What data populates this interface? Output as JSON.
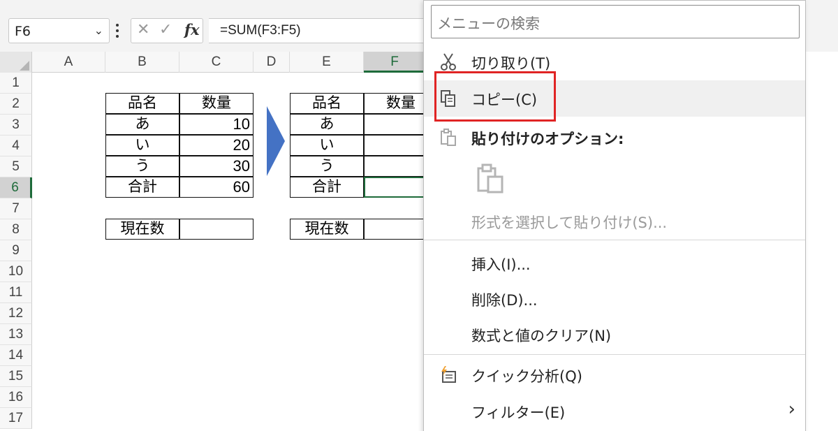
{
  "formula_bar": {
    "name_box": "F6",
    "name_box_chevron": "⌄",
    "cancel_icon": "✕",
    "enter_icon": "✓",
    "fx_label": "fx",
    "formula": "=SUM(F3:F5)"
  },
  "columns": [
    "A",
    "B",
    "C",
    "D",
    "E",
    "F"
  ],
  "rows": [
    "1",
    "2",
    "3",
    "4",
    "5",
    "6",
    "7",
    "8",
    "9",
    "10",
    "11",
    "12",
    "13",
    "14",
    "15",
    "16",
    "17"
  ],
  "active_cell": {
    "column": "F",
    "row": "6"
  },
  "left_table": {
    "header": [
      "品名",
      "数量"
    ],
    "rows": [
      [
        "あ",
        "10"
      ],
      [
        "い",
        "20"
      ],
      [
        "う",
        "30"
      ],
      [
        "合計",
        "60"
      ]
    ],
    "count_label": "現在数",
    "count_value": ""
  },
  "right_table": {
    "header": [
      "品名",
      "数量"
    ],
    "rows": [
      [
        "あ",
        ""
      ],
      [
        "い",
        ""
      ],
      [
        "う",
        ""
      ],
      [
        "合計",
        ""
      ]
    ],
    "count_label": "現在数"
  },
  "arrow_color": "#4472c4",
  "context_menu": {
    "search_placeholder": "メニューの検索",
    "items": {
      "cut": "切り取り(T)",
      "copy": "コピー(C)",
      "paste_options": "貼り付けのオプション:",
      "paste_special": "形式を選択して貼り付け(S)...",
      "insert": "挿入(I)...",
      "delete": "削除(D)...",
      "clear": "数式と値のクリア(N)",
      "quick_analysis": "クイック分析(Q)",
      "filter": "フィルター(E)"
    },
    "submenu_chevron": "›",
    "highlight_color": "#e02424"
  }
}
